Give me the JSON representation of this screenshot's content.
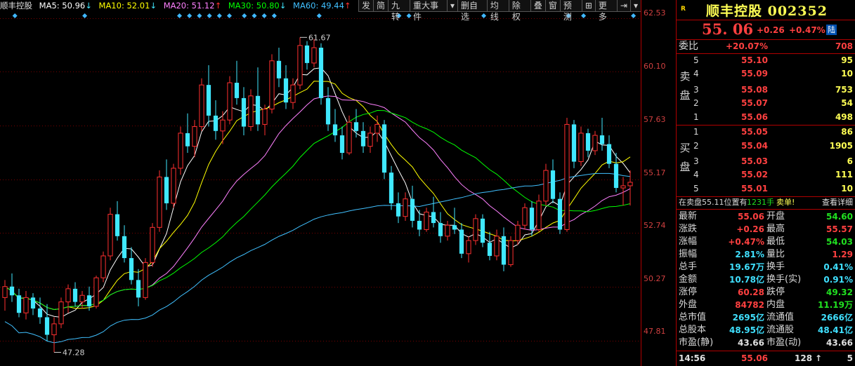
{
  "ma_legend": {
    "name": "顺丰控股",
    "ma5": "MA5: 50.96",
    "ma5_arrow": "↓",
    "ma10": "MA10: 52.01",
    "ma10_arrow": "↓",
    "ma20": "MA20: 51.12",
    "ma20_arrow": "↑",
    "ma30": "MA30: 50.80",
    "ma30_arrow": "↓",
    "ma60": "MA60: 49.44",
    "ma60_arrow": "↑",
    "colors": {
      "ma5": "#ffffff",
      "ma10": "#ffff00",
      "ma20": "#ff80ff",
      "ma30": "#00ff00",
      "ma60": "#40c0ff"
    }
  },
  "toolbar": {
    "items": [
      "发",
      "简",
      "九转",
      "重大事件",
      "▾",
      "删自选",
      "均线",
      "除权",
      "叠",
      "窗",
      "预测",
      "⊞",
      "更多",
      "⇥",
      "▾"
    ]
  },
  "chart": {
    "high_label": "61.67",
    "low_label": "47.28",
    "y_ticks": [
      "62.53",
      "60.10",
      "57.63",
      "55.17",
      "52.74",
      "50.27",
      "47.81"
    ],
    "up_color": "#ff3030",
    "down_color": "#40e8ff"
  },
  "chart_data": {
    "type": "candlestick",
    "ylim": [
      46.9,
      62.8
    ],
    "candles": [
      [
        49.8,
        50.6,
        49.2,
        50.3
      ],
      [
        50.3,
        50.9,
        49.6,
        49.9
      ],
      [
        49.9,
        50.2,
        48.9,
        49.1
      ],
      [
        49.1,
        50.1,
        48.8,
        49.8
      ],
      [
        49.8,
        50.0,
        49.0,
        49.3
      ],
      [
        49.3,
        49.8,
        48.6,
        48.9
      ],
      [
        48.9,
        49.5,
        47.8,
        48.1
      ],
      [
        48.1,
        48.9,
        47.3,
        48.6
      ],
      [
        48.6,
        49.8,
        48.4,
        49.6
      ],
      [
        49.6,
        50.4,
        49.1,
        50.2
      ],
      [
        50.2,
        50.5,
        49.4,
        49.6
      ],
      [
        49.6,
        50.1,
        49.3,
        49.9
      ],
      [
        49.9,
        50.3,
        49.2,
        49.4
      ],
      [
        49.4,
        50.8,
        49.3,
        50.7
      ],
      [
        50.7,
        51.9,
        50.5,
        51.7
      ],
      [
        51.7,
        53.9,
        51.5,
        53.6
      ],
      [
        53.6,
        54.2,
        52.4,
        52.6
      ],
      [
        52.6,
        53.1,
        51.4,
        51.6
      ],
      [
        51.6,
        52.1,
        50.4,
        50.6
      ],
      [
        50.6,
        51.1,
        49.4,
        49.8
      ],
      [
        49.8,
        51.6,
        49.7,
        51.4
      ],
      [
        51.4,
        53.2,
        51.2,
        53.0
      ],
      [
        53.0,
        55.6,
        52.8,
        55.3
      ],
      [
        55.3,
        56.1,
        53.8,
        54.1
      ],
      [
        54.1,
        55.9,
        53.9,
        55.7
      ],
      [
        55.7,
        57.6,
        55.4,
        57.3
      ],
      [
        57.3,
        58.2,
        56.4,
        56.7
      ],
      [
        56.7,
        57.9,
        56.2,
        57.6
      ],
      [
        57.6,
        59.8,
        57.4,
        59.5
      ],
      [
        59.5,
        60.4,
        57.6,
        58.1
      ],
      [
        58.1,
        58.8,
        57.0,
        57.4
      ],
      [
        57.4,
        58.3,
        56.8,
        57.9
      ],
      [
        57.9,
        59.9,
        57.7,
        59.6
      ],
      [
        59.6,
        60.6,
        58.6,
        58.9
      ],
      [
        58.9,
        59.4,
        57.2,
        57.6
      ],
      [
        57.6,
        59.3,
        57.4,
        59.0
      ],
      [
        59.0,
        60.3,
        57.4,
        57.7
      ],
      [
        57.7,
        58.6,
        57.2,
        58.4
      ],
      [
        58.4,
        60.9,
        58.2,
        60.6
      ],
      [
        60.6,
        61.2,
        59.4,
        59.8
      ],
      [
        59.8,
        60.4,
        58.4,
        58.7
      ],
      [
        58.7,
        59.8,
        58.4,
        59.5
      ],
      [
        59.5,
        61.67,
        59.3,
        61.3
      ],
      [
        61.3,
        61.5,
        60.2,
        60.5
      ],
      [
        60.5,
        61.6,
        60.3,
        61.2
      ],
      [
        61.2,
        61.4,
        58.6,
        58.9
      ],
      [
        58.9,
        59.4,
        57.4,
        57.7
      ],
      [
        57.7,
        58.4,
        56.9,
        57.2
      ],
      [
        57.2,
        57.6,
        56.1,
        56.4
      ],
      [
        56.4,
        58.1,
        56.3,
        57.8
      ],
      [
        57.8,
        58.4,
        57.1,
        57.4
      ],
      [
        57.4,
        57.8,
        56.4,
        56.7
      ],
      [
        56.7,
        57.6,
        56.4,
        57.3
      ],
      [
        57.3,
        58.1,
        56.9,
        57.7
      ],
      [
        57.7,
        57.9,
        55.2,
        55.5
      ],
      [
        55.5,
        55.8,
        53.8,
        54.1
      ],
      [
        54.1,
        54.6,
        53.2,
        53.5
      ],
      [
        53.5,
        54.6,
        53.3,
        54.3
      ],
      [
        54.3,
        54.9,
        53.0,
        53.3
      ],
      [
        53.3,
        53.8,
        52.6,
        52.9
      ],
      [
        52.9,
        53.9,
        52.8,
        53.7
      ],
      [
        53.7,
        54.4,
        53.0,
        53.2
      ],
      [
        53.2,
        53.7,
        52.3,
        52.6
      ],
      [
        52.6,
        53.3,
        52.4,
        53.1
      ],
      [
        53.1,
        53.9,
        52.7,
        52.9
      ],
      [
        52.9,
        53.2,
        51.6,
        51.8
      ],
      [
        51.8,
        52.6,
        51.4,
        52.4
      ],
      [
        52.4,
        53.6,
        52.2,
        53.4
      ],
      [
        53.4,
        53.6,
        52.1,
        52.3
      ],
      [
        52.3,
        52.8,
        51.5,
        51.7
      ],
      [
        51.7,
        52.9,
        51.5,
        52.6
      ],
      [
        52.6,
        53.0,
        51.0,
        51.3
      ],
      [
        51.3,
        52.6,
        51.2,
        52.4
      ],
      [
        52.4,
        53.3,
        52.2,
        53.1
      ],
      [
        53.1,
        54.1,
        52.9,
        53.9
      ],
      [
        53.9,
        54.2,
        52.6,
        52.9
      ],
      [
        52.9,
        54.5,
        52.8,
        54.2
      ],
      [
        54.2,
        55.9,
        54.0,
        55.6
      ],
      [
        55.6,
        56.1,
        54.1,
        54.3
      ],
      [
        54.3,
        54.6,
        52.7,
        52.9
      ],
      [
        52.9,
        58.0,
        52.8,
        57.7
      ],
      [
        57.7,
        57.9,
        55.7,
        56.0
      ],
      [
        56.0,
        57.6,
        55.8,
        57.3
      ],
      [
        57.3,
        57.5,
        56.2,
        56.5
      ],
      [
        56.5,
        57.4,
        56.3,
        57.2
      ],
      [
        57.2,
        58.0,
        56.5,
        56.8
      ],
      [
        56.8,
        57.2,
        55.7,
        55.9
      ],
      [
        55.9,
        56.4,
        54.6,
        54.8
      ],
      [
        54.8,
        55.3,
        54.0,
        54.9
      ],
      [
        54.9,
        55.6,
        54.0,
        55.06
      ]
    ]
  },
  "quote": {
    "r_badge": "R",
    "title": "顺丰控股 002352",
    "price": "55. 06",
    "change": "+0.26",
    "change_pct": "+0.47%",
    "exchange": "陆",
    "weibi_label": "委比",
    "weibi_pct": "+20.07%",
    "weibi_vol": "708",
    "sell_label": "卖盘",
    "buy_label": "买盘",
    "asks": [
      {
        "idx": "5",
        "price": "55.10",
        "vol": "95"
      },
      {
        "idx": "4",
        "price": "55.09",
        "vol": "10"
      },
      {
        "idx": "3",
        "price": "55.08",
        "vol": "753"
      },
      {
        "idx": "2",
        "price": "55.07",
        "vol": "54"
      },
      {
        "idx": "1",
        "price": "55.06",
        "vol": "498"
      }
    ],
    "bids": [
      {
        "idx": "1",
        "price": "55.05",
        "vol": "86"
      },
      {
        "idx": "2",
        "price": "55.04",
        "vol": "1905"
      },
      {
        "idx": "3",
        "price": "55.03",
        "vol": "6"
      },
      {
        "idx": "4",
        "price": "55.02",
        "vol": "111"
      },
      {
        "idx": "5",
        "price": "55.01",
        "vol": "10"
      }
    ],
    "notice_text": "在卖盘55.11位置有",
    "notice_vol": "1231手",
    "notice_action": "卖单!",
    "notice_link": "查看详细",
    "stats": [
      {
        "l1": "最新",
        "v1": "55.06",
        "c1": "red",
        "l2": "开盘",
        "v2": "54.60",
        "c2": "green"
      },
      {
        "l1": "涨跌",
        "v1": "+0.26",
        "c1": "red",
        "l2": "最高",
        "v2": "55.57",
        "c2": "red"
      },
      {
        "l1": "涨幅",
        "v1": "+0.47%",
        "c1": "red",
        "l2": "最低",
        "v2": "54.03",
        "c2": "green"
      },
      {
        "l1": "振幅",
        "v1": "2.81%",
        "c1": "cyan",
        "l2": "量比",
        "v2": "1.29",
        "c2": "red"
      },
      {
        "l1": "总手",
        "v1": "19.67万",
        "c1": "cyan",
        "l2": "换手",
        "v2": "0.41%",
        "c2": "cyan"
      },
      {
        "l1": "金额",
        "v1": "10.78亿",
        "c1": "cyan",
        "l2": "换手(实)",
        "v2": "0.91%",
        "c2": "cyan"
      },
      {
        "l1": "涨停",
        "v1": "60.28",
        "c1": "red",
        "l2": "跌停",
        "v2": "49.32",
        "c2": "green"
      },
      {
        "l1": "外盘",
        "v1": "84782",
        "c1": "red",
        "l2": "内盘",
        "v2": "11.19万",
        "c2": "green"
      },
      {
        "l1": "总市值",
        "v1": "2695亿",
        "c1": "cyan",
        "l2": "流通值",
        "v2": "2666亿",
        "c2": "cyan"
      },
      {
        "l1": "总股本",
        "v1": "48.95亿",
        "c1": "cyan",
        "l2": "流通股",
        "v2": "48.41亿",
        "c2": "cyan"
      },
      {
        "l1": "市盈(静)",
        "v1": "43.66",
        "c1": "white",
        "l2": "市盈(动)",
        "v2": "43.66",
        "c2": "white"
      }
    ],
    "last_trade": {
      "time": "14:56",
      "price": "55.06",
      "vol": "128",
      "dir": "↑",
      "count": "5"
    }
  }
}
